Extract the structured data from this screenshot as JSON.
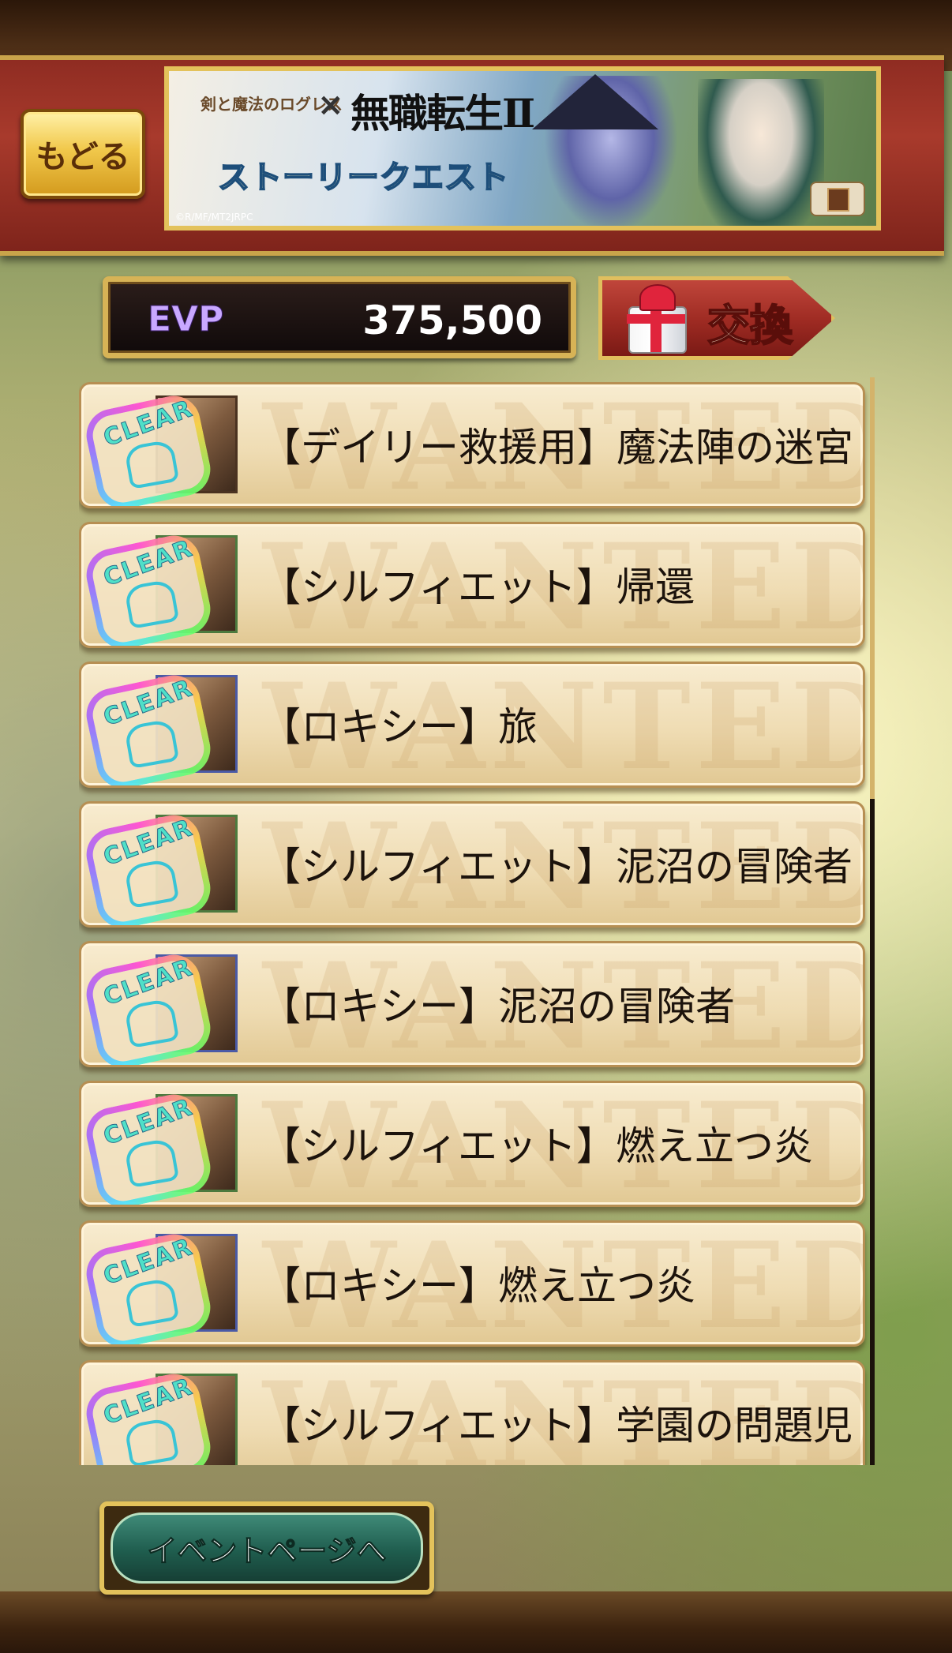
{
  "header": {
    "back_label": "もどる",
    "banner": {
      "logo_left": "剣と魔法のログレス",
      "cross": "×",
      "logo_right": "無職転生Ⅱ",
      "subtitle": "ストーリークエスト",
      "copyright": "©R/MF/MT2JRPC"
    }
  },
  "evp": {
    "label": "EVP",
    "value": "375,500"
  },
  "exchange": {
    "label": "交換"
  },
  "quests": [
    {
      "title": "【デイリー救援用】魔法陣の迷宮",
      "badge": "CLEAR",
      "watermark": "WANTED"
    },
    {
      "title": "【シルフィエット】帰還",
      "badge": "CLEAR",
      "watermark": "WANTED"
    },
    {
      "title": "【ロキシー】旅",
      "badge": "CLEAR",
      "watermark": "WANTED"
    },
    {
      "title": "【シルフィエット】泥沼の冒険者",
      "badge": "CLEAR",
      "watermark": "WANTED"
    },
    {
      "title": "【ロキシー】泥沼の冒険者",
      "badge": "CLEAR",
      "watermark": "WANTED"
    },
    {
      "title": "【シルフィエット】燃え立つ炎",
      "badge": "CLEAR",
      "watermark": "WANTED"
    },
    {
      "title": "【ロキシー】燃え立つ炎",
      "badge": "CLEAR",
      "watermark": "WANTED"
    },
    {
      "title": "【シルフィエット】学園の問題児",
      "badge": "CLEAR",
      "watermark": "WANTED"
    }
  ],
  "footer": {
    "event_button_label": "イベントページへ"
  }
}
